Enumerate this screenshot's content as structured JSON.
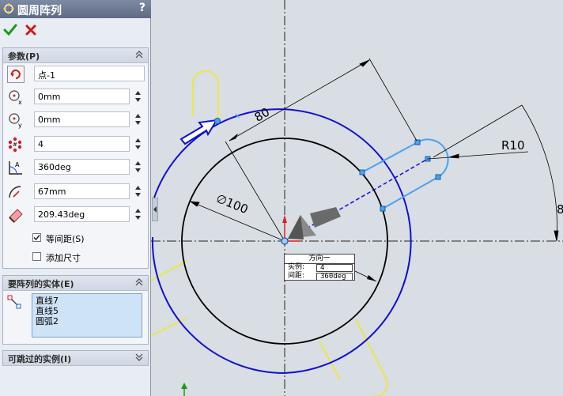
{
  "panel": {
    "title": "圆周阵列",
    "help": "?",
    "params_header": "参数(P)",
    "center_point": "点-1",
    "center_x": "0mm",
    "center_y": "0mm",
    "instances": "4",
    "total_angle": "360deg",
    "radius": "67mm",
    "arc_angle": "209.43deg",
    "equal_spacing_label": "等间距(S)",
    "equal_spacing_checked": true,
    "add_dimensions_label": "添加尺寸",
    "add_dimensions_checked": false,
    "entities_header": "要阵列的实体(E)",
    "entities": [
      "直线7",
      "直线5",
      "圆弧2"
    ],
    "skip_header": "可跳过的实例(I)"
  },
  "sketch": {
    "dim_80": "80",
    "dim_r10": "R10",
    "dim_diam": "∅100",
    "dim_8": "8",
    "pattern_table": {
      "header": "方向一",
      "instances_label": "实例:",
      "instances_value": "4",
      "spacing_label": "间距:",
      "spacing_value": "360deg"
    },
    "colors": {
      "blue": "#0000d0",
      "light_blue": "#4aa3ee",
      "yellow": "#e8e84a",
      "black": "#000000"
    }
  }
}
